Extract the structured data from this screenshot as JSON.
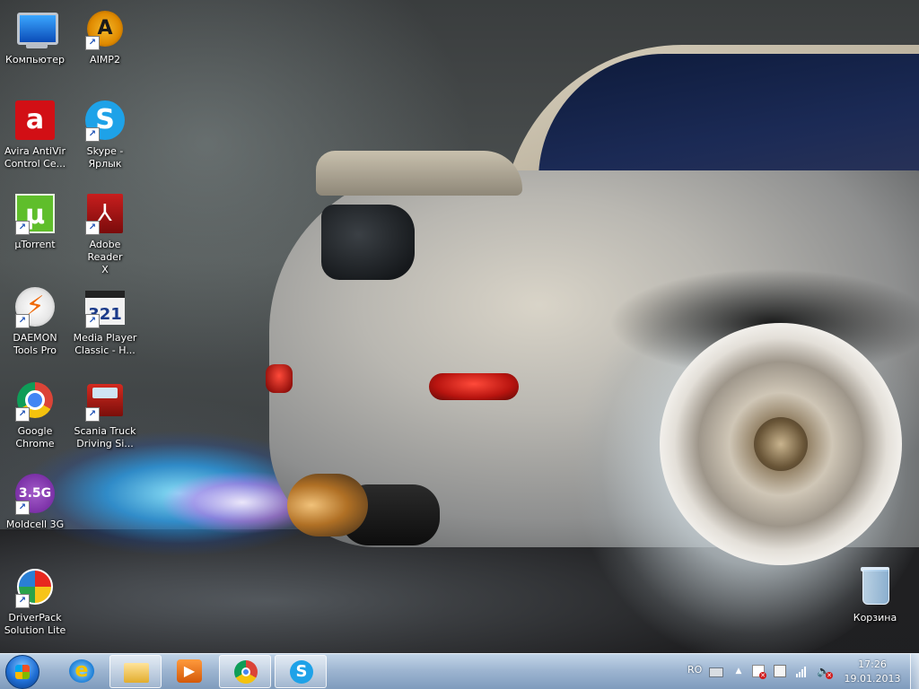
{
  "desktop": {
    "icons": [
      {
        "label": "Компьютер",
        "glyph": "computer-icon"
      },
      {
        "label": "AIMP2",
        "glyph": "aimp-icon"
      },
      {
        "label": "Avira AntiVir\nControl Ce...",
        "glyph": "avira-icon"
      },
      {
        "label": "Skype -\nЯрлык",
        "glyph": "skype-icon"
      },
      {
        "label": "µTorrent",
        "glyph": "utorrent-icon"
      },
      {
        "label": "Adobe Reader\nX",
        "glyph": "adobe-reader-icon"
      },
      {
        "label": "DAEMON\nTools Pro",
        "glyph": "daemon-tools-icon"
      },
      {
        "label": "Media Player\nClassic - H...",
        "glyph": "media-player-classic-icon"
      },
      {
        "label": "Google\nChrome",
        "glyph": "chrome-icon"
      },
      {
        "label": "Scania Truck\nDriving Si...",
        "glyph": "scania-truck-icon"
      },
      {
        "label": "Moldcell 3G",
        "glyph": "moldcell-icon"
      },
      {
        "label": "DriverPack\nSolution Lite",
        "glyph": "driverpack-icon"
      },
      {
        "label": "Корзина",
        "glyph": "recycle-bin-icon"
      }
    ],
    "glyph_text": {
      "aimp": "A",
      "avira": "a",
      "skype": "S",
      "utorrent": "µ",
      "adobe": "⅄",
      "daemon": "⚡",
      "mpc": "321",
      "moldcell": "3.5G",
      "shortcut_arrow": "↗"
    }
  },
  "taskbar": {
    "start_label": "Start",
    "pinned": [
      {
        "name": "Internet Explorer",
        "glyph": "internet-explorer-icon",
        "active": false
      },
      {
        "name": "Windows Explorer",
        "glyph": "folder-icon",
        "active": true
      },
      {
        "name": "Windows Media Player",
        "glyph": "media-player-icon",
        "active": false
      },
      {
        "name": "Google Chrome",
        "glyph": "chrome-icon",
        "active": true
      },
      {
        "name": "Skype",
        "glyph": "skype-icon",
        "active": true
      }
    ],
    "glyph_text": {
      "ie": "e",
      "wmp": "▶",
      "skype": "S"
    },
    "tray": {
      "language": "RO",
      "arrow": "▲",
      "speaker": "🔈",
      "x_mark": "✕"
    },
    "clock": {
      "time": "17:26",
      "date": "19.01.2013"
    }
  }
}
